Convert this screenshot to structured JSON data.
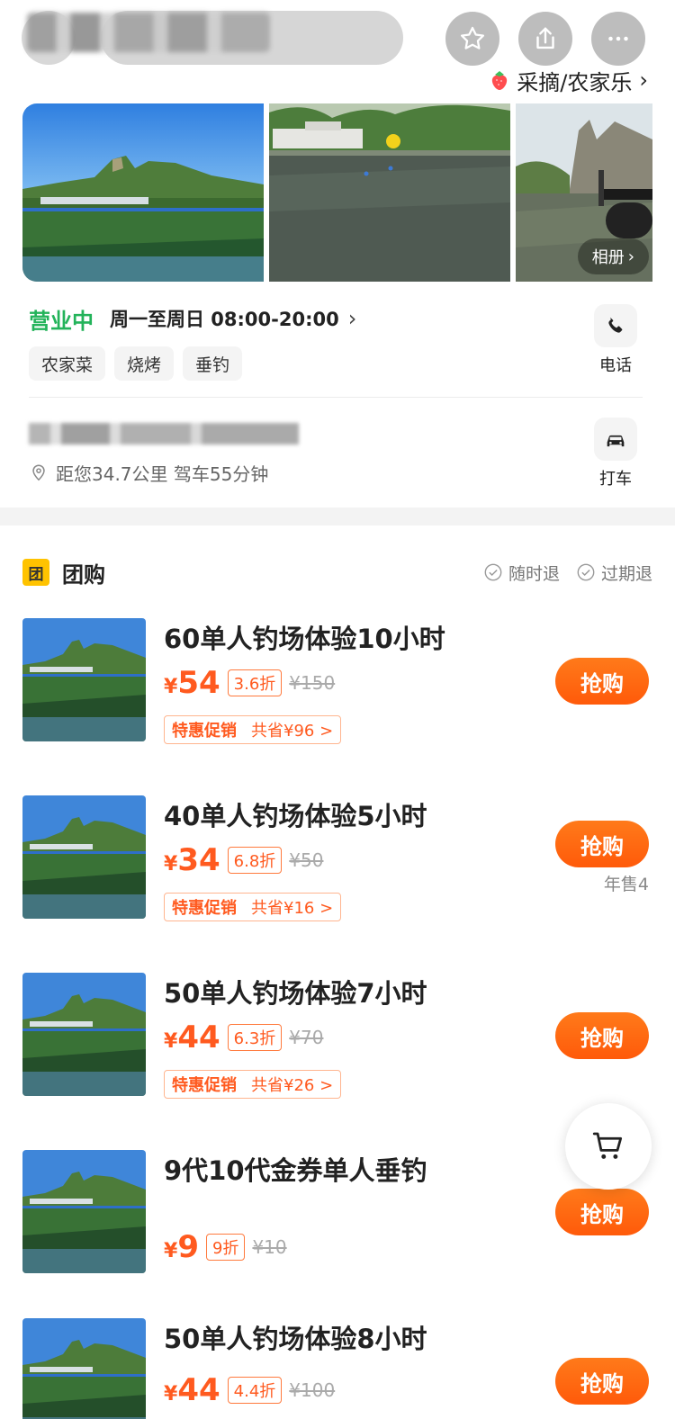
{
  "header": {
    "category": "采摘/农家乐"
  },
  "gallery": {
    "album_label": "相册"
  },
  "info": {
    "status": "营业中",
    "hours": "周一至周日 08:00-20:00",
    "tags": [
      "农家菜",
      "烧烤",
      "垂钓"
    ],
    "phone_label": "电话",
    "distance": "距您34.7公里 驾车55分钟",
    "taxi_label": "打车"
  },
  "group_buy": {
    "title": "团购",
    "badge": "团",
    "policies": [
      "随时退",
      "过期退"
    ],
    "deals": [
      {
        "title": "60单人钓场体验10小时",
        "yen": "¥",
        "price": "54",
        "discount": "3.6折",
        "original": "¥150",
        "promo_tag": "特惠促销",
        "promo_save": "共省¥96 >",
        "button": "抢购",
        "sold": ""
      },
      {
        "title": "40单人钓场体验5小时",
        "yen": "¥",
        "price": "34",
        "discount": "6.8折",
        "original": "¥50",
        "promo_tag": "特惠促销",
        "promo_save": "共省¥16 >",
        "button": "抢购",
        "sold": "年售4"
      },
      {
        "title": "50单人钓场体验7小时",
        "yen": "¥",
        "price": "44",
        "discount": "6.3折",
        "original": "¥70",
        "promo_tag": "特惠促销",
        "promo_save": "共省¥26 >",
        "button": "抢购",
        "sold": ""
      },
      {
        "title": "9代10代金券单人垂钓",
        "yen": "¥",
        "price": "9",
        "discount": "9折",
        "original": "¥10",
        "button": "抢购"
      },
      {
        "title": "50单人钓场体验8小时",
        "yen": "¥",
        "price": "44",
        "discount": "4.4折",
        "original": "¥100",
        "button": "抢购"
      }
    ]
  },
  "colors": {
    "accent": "#ff5a1f",
    "open_green": "#23b35a",
    "badge_yellow": "#ffc300"
  }
}
